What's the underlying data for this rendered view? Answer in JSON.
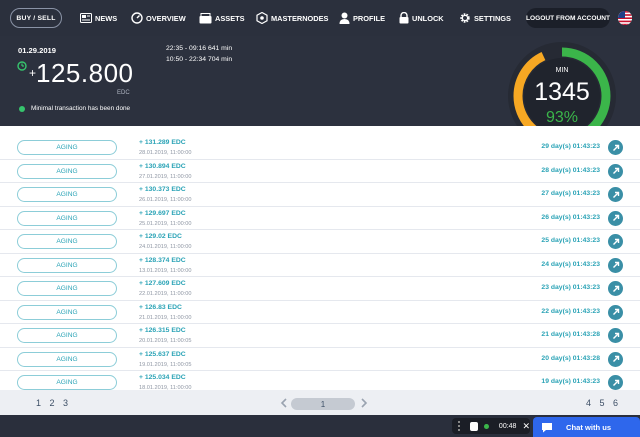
{
  "nav": {
    "buy_sell": "BUY / SELL",
    "items": [
      {
        "label": "NEWS",
        "icon": "news-icon"
      },
      {
        "label": "OVERVIEW",
        "icon": "overview-icon"
      },
      {
        "label": "ASSETS",
        "icon": "assets-icon"
      },
      {
        "label": "MASTERNODES",
        "icon": "masternodes-icon"
      },
      {
        "label": "PROFILE",
        "icon": "profile-icon"
      },
      {
        "label": "UNLOCK",
        "icon": "lock-icon"
      },
      {
        "label": "SETTINGS",
        "icon": "gear-icon"
      }
    ],
    "logout": "LOGOUT FROM ACCOUNT",
    "flag_icon": "us-flag-icon"
  },
  "header": {
    "date": "01.29.2019",
    "plus_sign": "+",
    "amount": "125.800",
    "unit": "EDC",
    "status": "Minimal transaction has been done",
    "time_ranges": [
      "22:35 - 09:16 641 min",
      "10:50 - 22:34 704 min"
    ]
  },
  "gauge": {
    "label": "MIN",
    "value": "1345",
    "percent": "93%",
    "percent_value": 93,
    "colors": {
      "green": "#3bb54a",
      "orange": "#f7a823",
      "ring_bg": "#1f232d"
    }
  },
  "rows": [
    {
      "status": "AGING",
      "amount": "+ 131.289 EDC",
      "date": "28.01.2019, 11:00:00",
      "duration": "29 day(s) 01:43:23"
    },
    {
      "status": "AGING",
      "amount": "+ 130.894 EDC",
      "date": "27.01.2019, 11:00:00",
      "duration": "28 day(s) 01:43:23"
    },
    {
      "status": "AGING",
      "amount": "+ 130.373 EDC",
      "date": "26.01.2019, 11:00:00",
      "duration": "27 day(s) 01:43:23"
    },
    {
      "status": "AGING",
      "amount": "+ 129.697 EDC",
      "date": "25.01.2019, 11:00:00",
      "duration": "26 day(s) 01:43:23"
    },
    {
      "status": "AGING",
      "amount": "+ 129.02 EDC",
      "date": "24.01.2019, 11:00:00",
      "duration": "25 day(s) 01:43:23"
    },
    {
      "status": "AGING",
      "amount": "+ 128.374 EDC",
      "date": "13.01.2019, 11:00:00",
      "duration": "24 day(s) 01:43:23"
    },
    {
      "status": "AGING",
      "amount": "+ 127.609 EDC",
      "date": "22.01.2019, 11:00:00",
      "duration": "23 day(s) 01:43:23"
    },
    {
      "status": "AGING",
      "amount": "+ 126.83 EDC",
      "date": "21.01.2019, 11:00:00",
      "duration": "22 day(s) 01:43:23"
    },
    {
      "status": "AGING",
      "amount": "+ 126.315 EDC",
      "date": "20.01.2019, 11:00:05",
      "duration": "21 day(s) 01:43:28"
    },
    {
      "status": "AGING",
      "amount": "+ 125.637 EDC",
      "date": "19.01.2019, 11:00:05",
      "duration": "20 day(s) 01:43:28"
    },
    {
      "status": "AGING",
      "amount": "+ 125.034 EDC",
      "date": "18.01.2019, 11:00:00",
      "duration": "19 day(s) 01:43:23"
    }
  ],
  "pagination": {
    "left_pages": "1 2 3",
    "current": "1",
    "right_pages": "4 5 6"
  },
  "bottom": {
    "timer": "00:48",
    "chat_label": "Chat with us",
    "accent": "#2e67ec"
  }
}
